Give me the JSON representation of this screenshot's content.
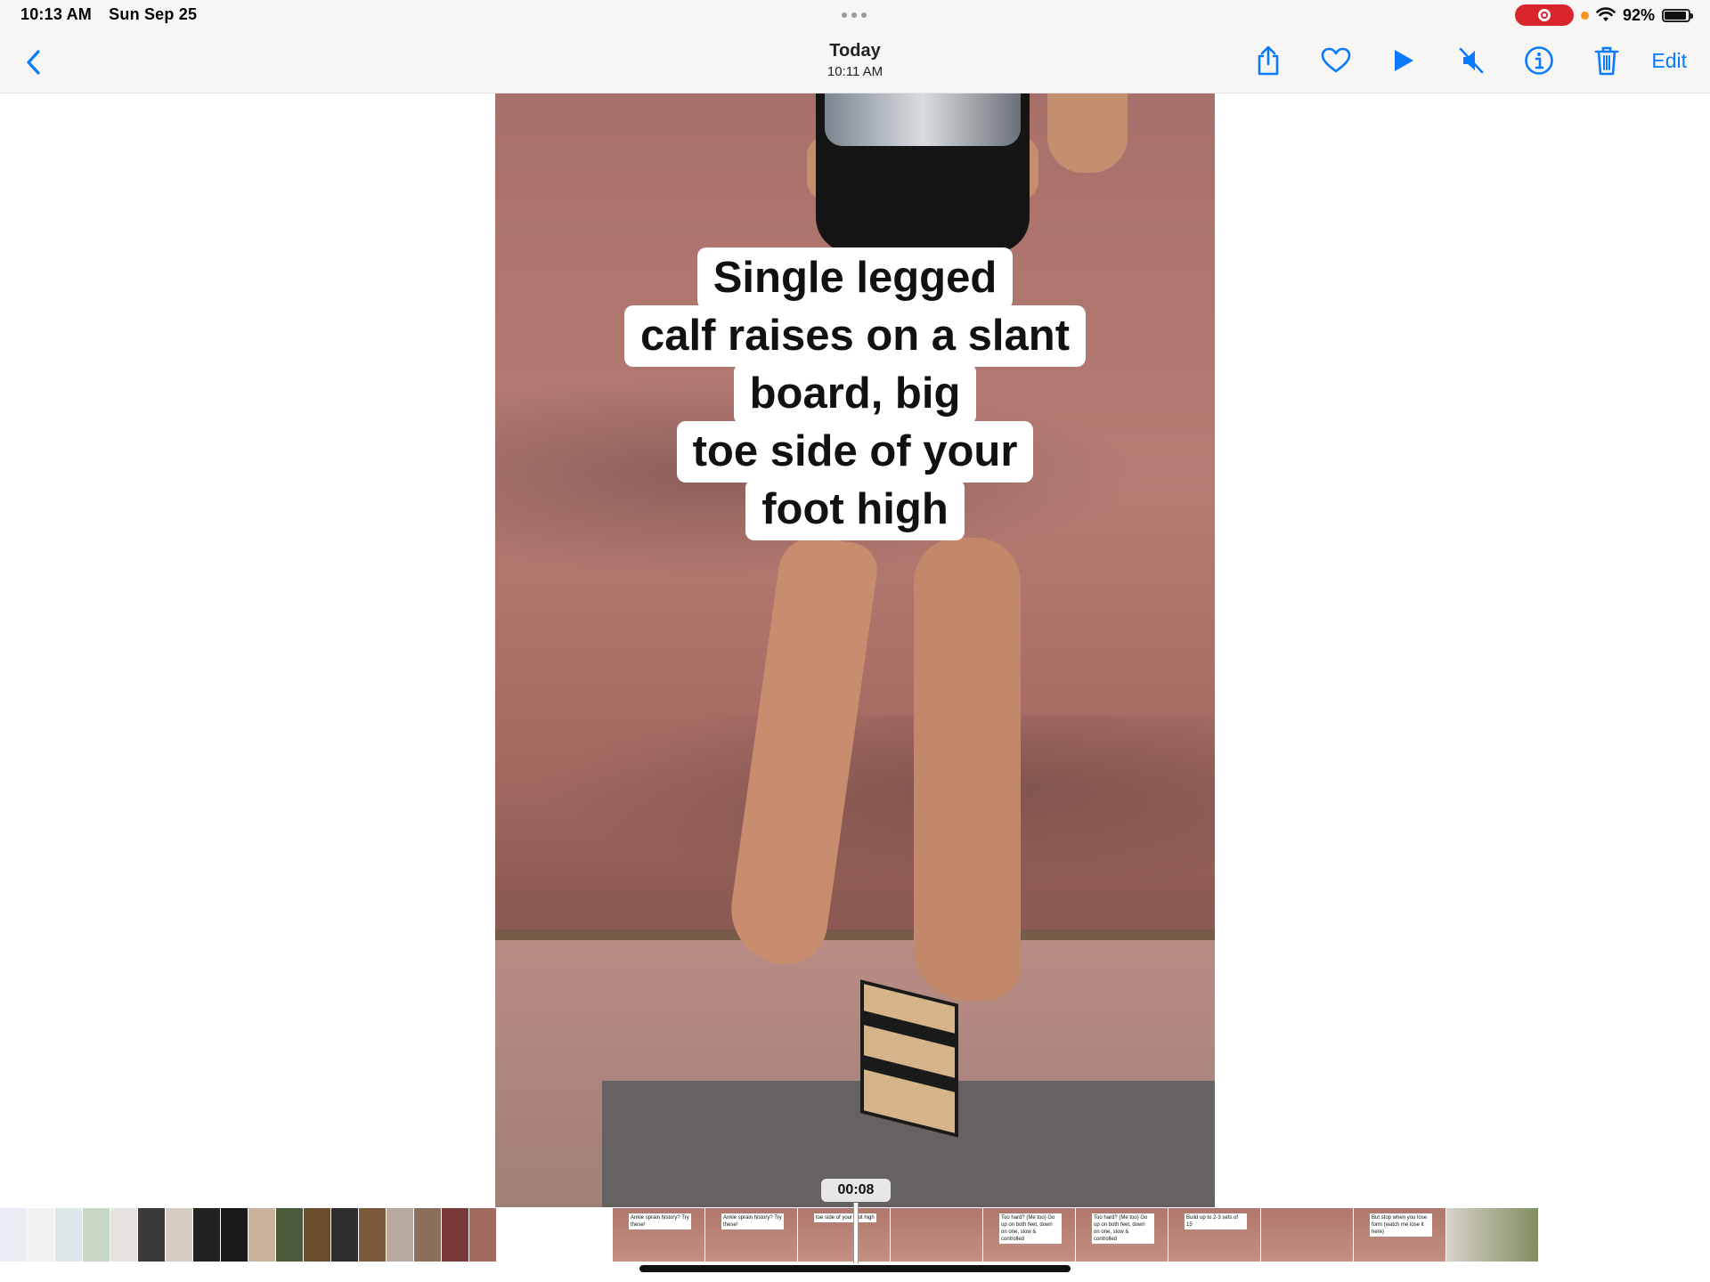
{
  "status_bar": {
    "time": "10:13 AM",
    "date": "Sun Sep 25",
    "battery_percent": "92%",
    "battery_level": 0.92,
    "icons": [
      "screen-record-icon",
      "mic-indicator-icon",
      "wifi-icon",
      "battery-icon"
    ]
  },
  "nav": {
    "title": "Today",
    "subtitle": "10:11 AM",
    "edit_label": "Edit",
    "accent_color": "#0a7aff",
    "icons": [
      "back-chevron-icon",
      "share-icon",
      "heart-icon",
      "play-icon",
      "mute-icon",
      "info-icon",
      "trash-icon"
    ]
  },
  "video": {
    "caption_lines": [
      "Single legged",
      "calf raises on a slant",
      "board, big",
      "toe side of your",
      "foot high"
    ],
    "timestamp": "00:08"
  },
  "thumbnail_strip": {
    "frame_labels": [
      "Ankle sprain history? Try these!",
      "Ankle sprain history? Try these!",
      "toe side of your foot high",
      "",
      "Too hard? (Me too) Go up on both feet, down on one, slow & controlled",
      "Too hard? (Me too) Go up on both feet, down on one, slow & controlled",
      "Build up to 2-3 sets of 15",
      "",
      "But stop when you lose form (watch me lose it here)",
      ""
    ]
  }
}
